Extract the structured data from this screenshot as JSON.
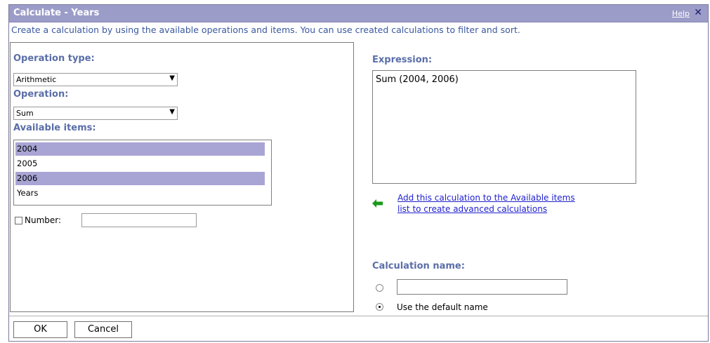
{
  "dialog": {
    "title": "Calculate - Years",
    "help_label": "Help",
    "close_glyph": "✕",
    "intro": "Create a calculation by using the available operations and items. You can use created calculations to filter and sort."
  },
  "left": {
    "operation_type_label": "Operation type:",
    "operation_type_value": "Arithmetic",
    "operation_label": "Operation:",
    "operation_value": "Sum",
    "available_items_label": "Available items:",
    "items": [
      {
        "label": "2004",
        "selected": true
      },
      {
        "label": "2005",
        "selected": false
      },
      {
        "label": "2006",
        "selected": true
      },
      {
        "label": "Years",
        "selected": false
      }
    ],
    "number_label": "Number:",
    "number_value": "",
    "number_checked": false
  },
  "right": {
    "expression_label": "Expression:",
    "expression_value": "Sum (2004, 2006)",
    "add_link_line1": "Add this calculation to the Available items",
    "add_link_line2": "list to create advanced calculations",
    "add_icon": "green-left-arrow-icon",
    "calc_name_label": "Calculation name:",
    "calc_name_value": "",
    "default_name_label": "Use the default name",
    "default_name_selected": true
  },
  "buttons": {
    "ok": "OK",
    "cancel": "Cancel"
  },
  "colors": {
    "titlebar": "#9c9cc8",
    "label": "#5a6ea8",
    "selection": "#a8a4d4",
    "link": "#2020d0",
    "arrow": "#1a9a1a"
  }
}
